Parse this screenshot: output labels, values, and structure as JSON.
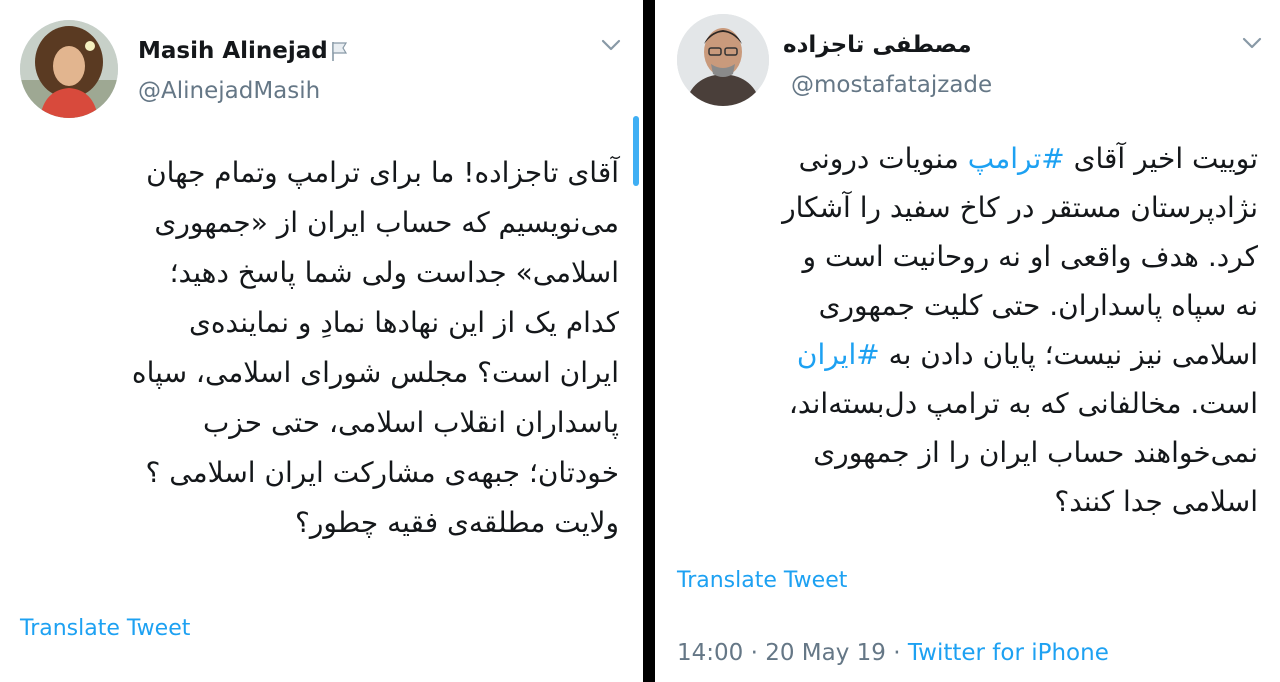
{
  "left_tweet": {
    "user_name": "Masih Alinejad",
    "user_handle": "@AlinejadMasih",
    "body_lines": [
      "آقای تاجزاده! ما برای ترامپ وتمام جهان",
      "می‌نویسیم که حساب ایران از «جمهوری",
      "اسلامی» جداست ولی شما پاسخ دهید؛",
      "کدام یک از این نهادها نمادِ و نماینده‌ی",
      "ایران است؟ مجلس شورای اسلامی، سپاه",
      "پاسداران انقلاب اسلامی،  حتی حزب",
      "خودتان؛ جبهه‌ی مشارکت ایران اسلامی ؟",
      "ولایت مطلقه‌ی فقیه چطور؟"
    ],
    "translate_label": "Translate Tweet"
  },
  "right_tweet": {
    "user_name": "مصطفی تاجزاده",
    "user_handle": "@mostafatajzade",
    "line1_pre": "توییت اخیر آقای ",
    "hashtag_trump": "#ترامپ",
    "line1_post": " منویات درونی",
    "line2": "نژادپرستان مستقر در کاخ سفید را آشکار",
    "line3": "کرد. هدف واقعی او نه روحانیت است و",
    "line4": "نه سپاه پاسداران. حتی کلیت جمهوری",
    "line5_pre": "اسلامی نیز نیست؛ پایان دادن به ",
    "hashtag_iran": "#ایران",
    "line6": "است. مخالفانی که به ترامپ دل‌بسته‌اند،",
    "line7": "نمی‌خواهند حساب ایران را از جمهوری",
    "line8": "اسلامی جدا کنند؟",
    "translate_label": "Translate Tweet",
    "time": "14:00",
    "date": "20 May 19",
    "source": "Twitter for iPhone"
  },
  "colors": {
    "link_blue": "#1da1f2",
    "secondary_gray": "#657786",
    "divider": "#000000"
  },
  "icons": {
    "flag": "flag-icon",
    "caret": "chevron-down-icon"
  }
}
